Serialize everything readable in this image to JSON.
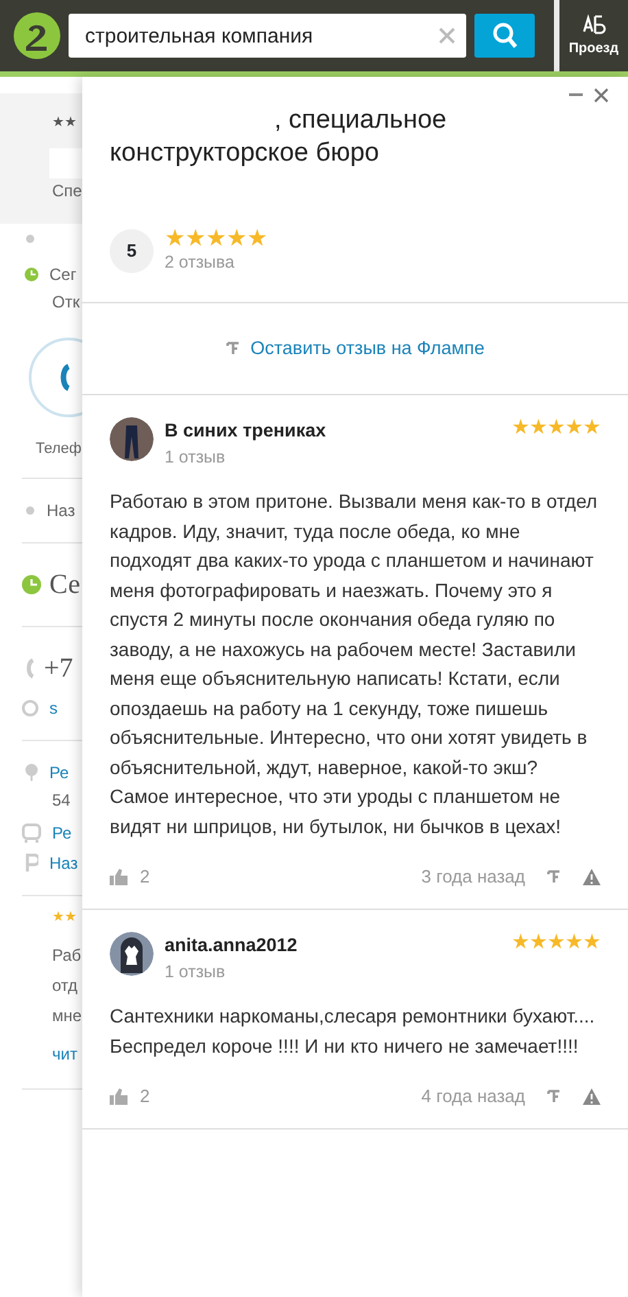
{
  "header": {
    "search": {
      "value": "строительная компания"
    },
    "route_button": {
      "label": "Проезд"
    }
  },
  "background_card": {
    "items": [
      {
        "kind": "stars",
        "text": "★★"
      },
      {
        "kind": "blank"
      },
      {
        "kind": "text",
        "text": "Спе"
      },
      {
        "kind": "divider"
      },
      {
        "kind": "dot"
      },
      {
        "kind": "clock",
        "text": "Сег"
      },
      {
        "kind": "text",
        "text": "Отк"
      },
      {
        "kind": "phone",
        "text": "Телеф"
      },
      {
        "kind": "divider"
      },
      {
        "kind": "dot",
        "text": "Наз"
      },
      {
        "kind": "divider"
      },
      {
        "kind": "clock-large",
        "text": "Се"
      },
      {
        "kind": "divider"
      },
      {
        "kind": "phone-large",
        "text": "+7"
      },
      {
        "kind": "globe",
        "text": "s"
      },
      {
        "kind": "divider"
      },
      {
        "kind": "pin",
        "text": "Ре"
      },
      {
        "kind": "text",
        "text": "54"
      },
      {
        "kind": "bus",
        "text": "Ре"
      },
      {
        "kind": "parking",
        "text": "Наз"
      },
      {
        "kind": "divider"
      },
      {
        "kind": "stars-gold",
        "text": "★★"
      },
      {
        "kind": "text",
        "text": "Раб"
      },
      {
        "kind": "text",
        "text": "отд"
      },
      {
        "kind": "text",
        "text": "мне"
      },
      {
        "kind": "link",
        "text": "чит"
      },
      {
        "kind": "divider"
      }
    ]
  },
  "panel": {
    "title": ", специальное\nконструкторское бюро",
    "rating": {
      "score": "5",
      "stars": 5,
      "count": "2 отзыва"
    },
    "leave_review": "Оставить отзыв на Флампе",
    "reviews": [
      {
        "author": "В синих трениках",
        "reviews_count": "1 отзыв",
        "stars": 5,
        "text": "Работаю в этом притоне. Вызвали меня как-то в отдел кадров. Иду, значит, туда после обеда, ко мне подходят два каких-то урода с планшетом и начинают меня фотографировать и наезжать. Почему это я спустя 2 минуты после окончания обеда гуляю по заводу, а не нахожусь на рабочем месте! Заставили меня еще объяснительную написать! Кстати, если опоздаешь на работу на 1 секунду, тоже пишешь объяснительные. Интересно, что они хотят увидеть в объяснительной, ждут, наверное, какой-то экш? Самое интересное, что эти уроды с планшетом не видят ни шприцов, ни бутылок, ни бычков в цехах!",
        "likes": "2",
        "time": "3 года назад"
      },
      {
        "author": "anita.anna2012",
        "reviews_count": "1 отзыв",
        "stars": 5,
        "text": "Сантехники наркоманы,слесаря ремонтники бухают.... Беспредел короче !!!! И ни кто ничего не замечает!!!!",
        "likes": "2",
        "time": "4 года назад"
      }
    ]
  }
}
